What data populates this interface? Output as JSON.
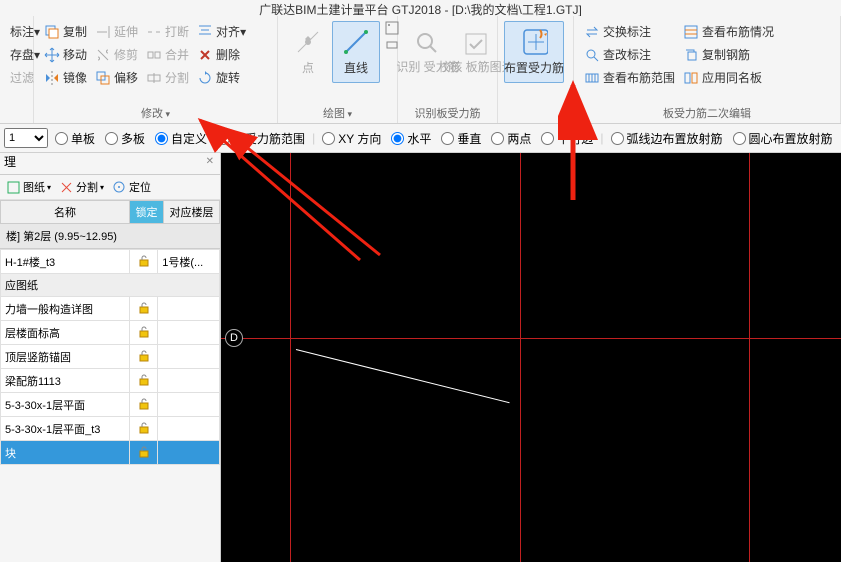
{
  "title": "广联达BIM土建计量平台 GTJ2018 - [D:\\我的文档\\工程1.GTJ]",
  "ribbon": {
    "g0": {
      "btn1": "标注",
      "btn2": "存盘",
      "btn3": "过滤"
    },
    "modify": {
      "label": "修改",
      "copy": "复制",
      "move": "移动",
      "mirror": "镜像",
      "extend": "延伸",
      "trim": "修剪",
      "offset": "偏移",
      "break": "打断",
      "merge": "合并",
      "split": "分割",
      "align": "对齐",
      "delete": "删除",
      "rotate": "旋转"
    },
    "draw": {
      "label": "绘图",
      "point": "点",
      "line": "直线"
    },
    "recog": {
      "label": "识别板受力筋",
      "recog": "识别\n受力筋",
      "check": "校核\n板筋图元"
    },
    "place": {
      "label": "",
      "btn": "布置受力筋"
    },
    "edit": {
      "label": "板受力筋二次编辑",
      "swap": "交换标注",
      "view": "查看布筋情况",
      "mod": "查改标注",
      "copyr": "复制钢筋",
      "range": "查看布筋范围",
      "apply": "应用同名板"
    }
  },
  "options": {
    "sel": "1",
    "single": "单板",
    "multi": "多板",
    "custom": "自定义",
    "byforce": "按受力筋范围",
    "xy": "XY 方向",
    "hor": "水平",
    "ver": "垂直",
    "two": "两点",
    "edge": "平行边",
    "arc": "弧线边布置放射筋",
    "circ": "圆心布置放射筋"
  },
  "side": {
    "tab": "理",
    "drawing": "图纸",
    "split": "分割",
    "locate": "定位",
    "col_name": "名称",
    "col_lock": "锁定",
    "col_floor": "对应楼层",
    "layer": "楼] 第2层 (9.95~12.95)",
    "rows": [
      {
        "name": "H-1#楼_t3",
        "floor": "1号楼(...",
        "lock": true
      },
      {
        "name": "应图纸",
        "floor": "",
        "hdr": true
      },
      {
        "name": "力墙一般构造详图",
        "floor": "",
        "lock": true
      },
      {
        "name": "层楼面标高",
        "floor": "",
        "lock": true
      },
      {
        "name": "顶层竖筋锚固",
        "floor": "",
        "lock": true
      },
      {
        "name": "梁配筋1113",
        "floor": "",
        "lock": true
      },
      {
        "name": "5-3-30x-1层平面",
        "floor": "",
        "lock": true
      },
      {
        "name": "5-3-30x-1层平面_t3",
        "floor": "",
        "lock": true
      },
      {
        "name": "块",
        "floor": "",
        "lock": true,
        "sel": true
      }
    ]
  },
  "axis": {
    "d": "D"
  }
}
